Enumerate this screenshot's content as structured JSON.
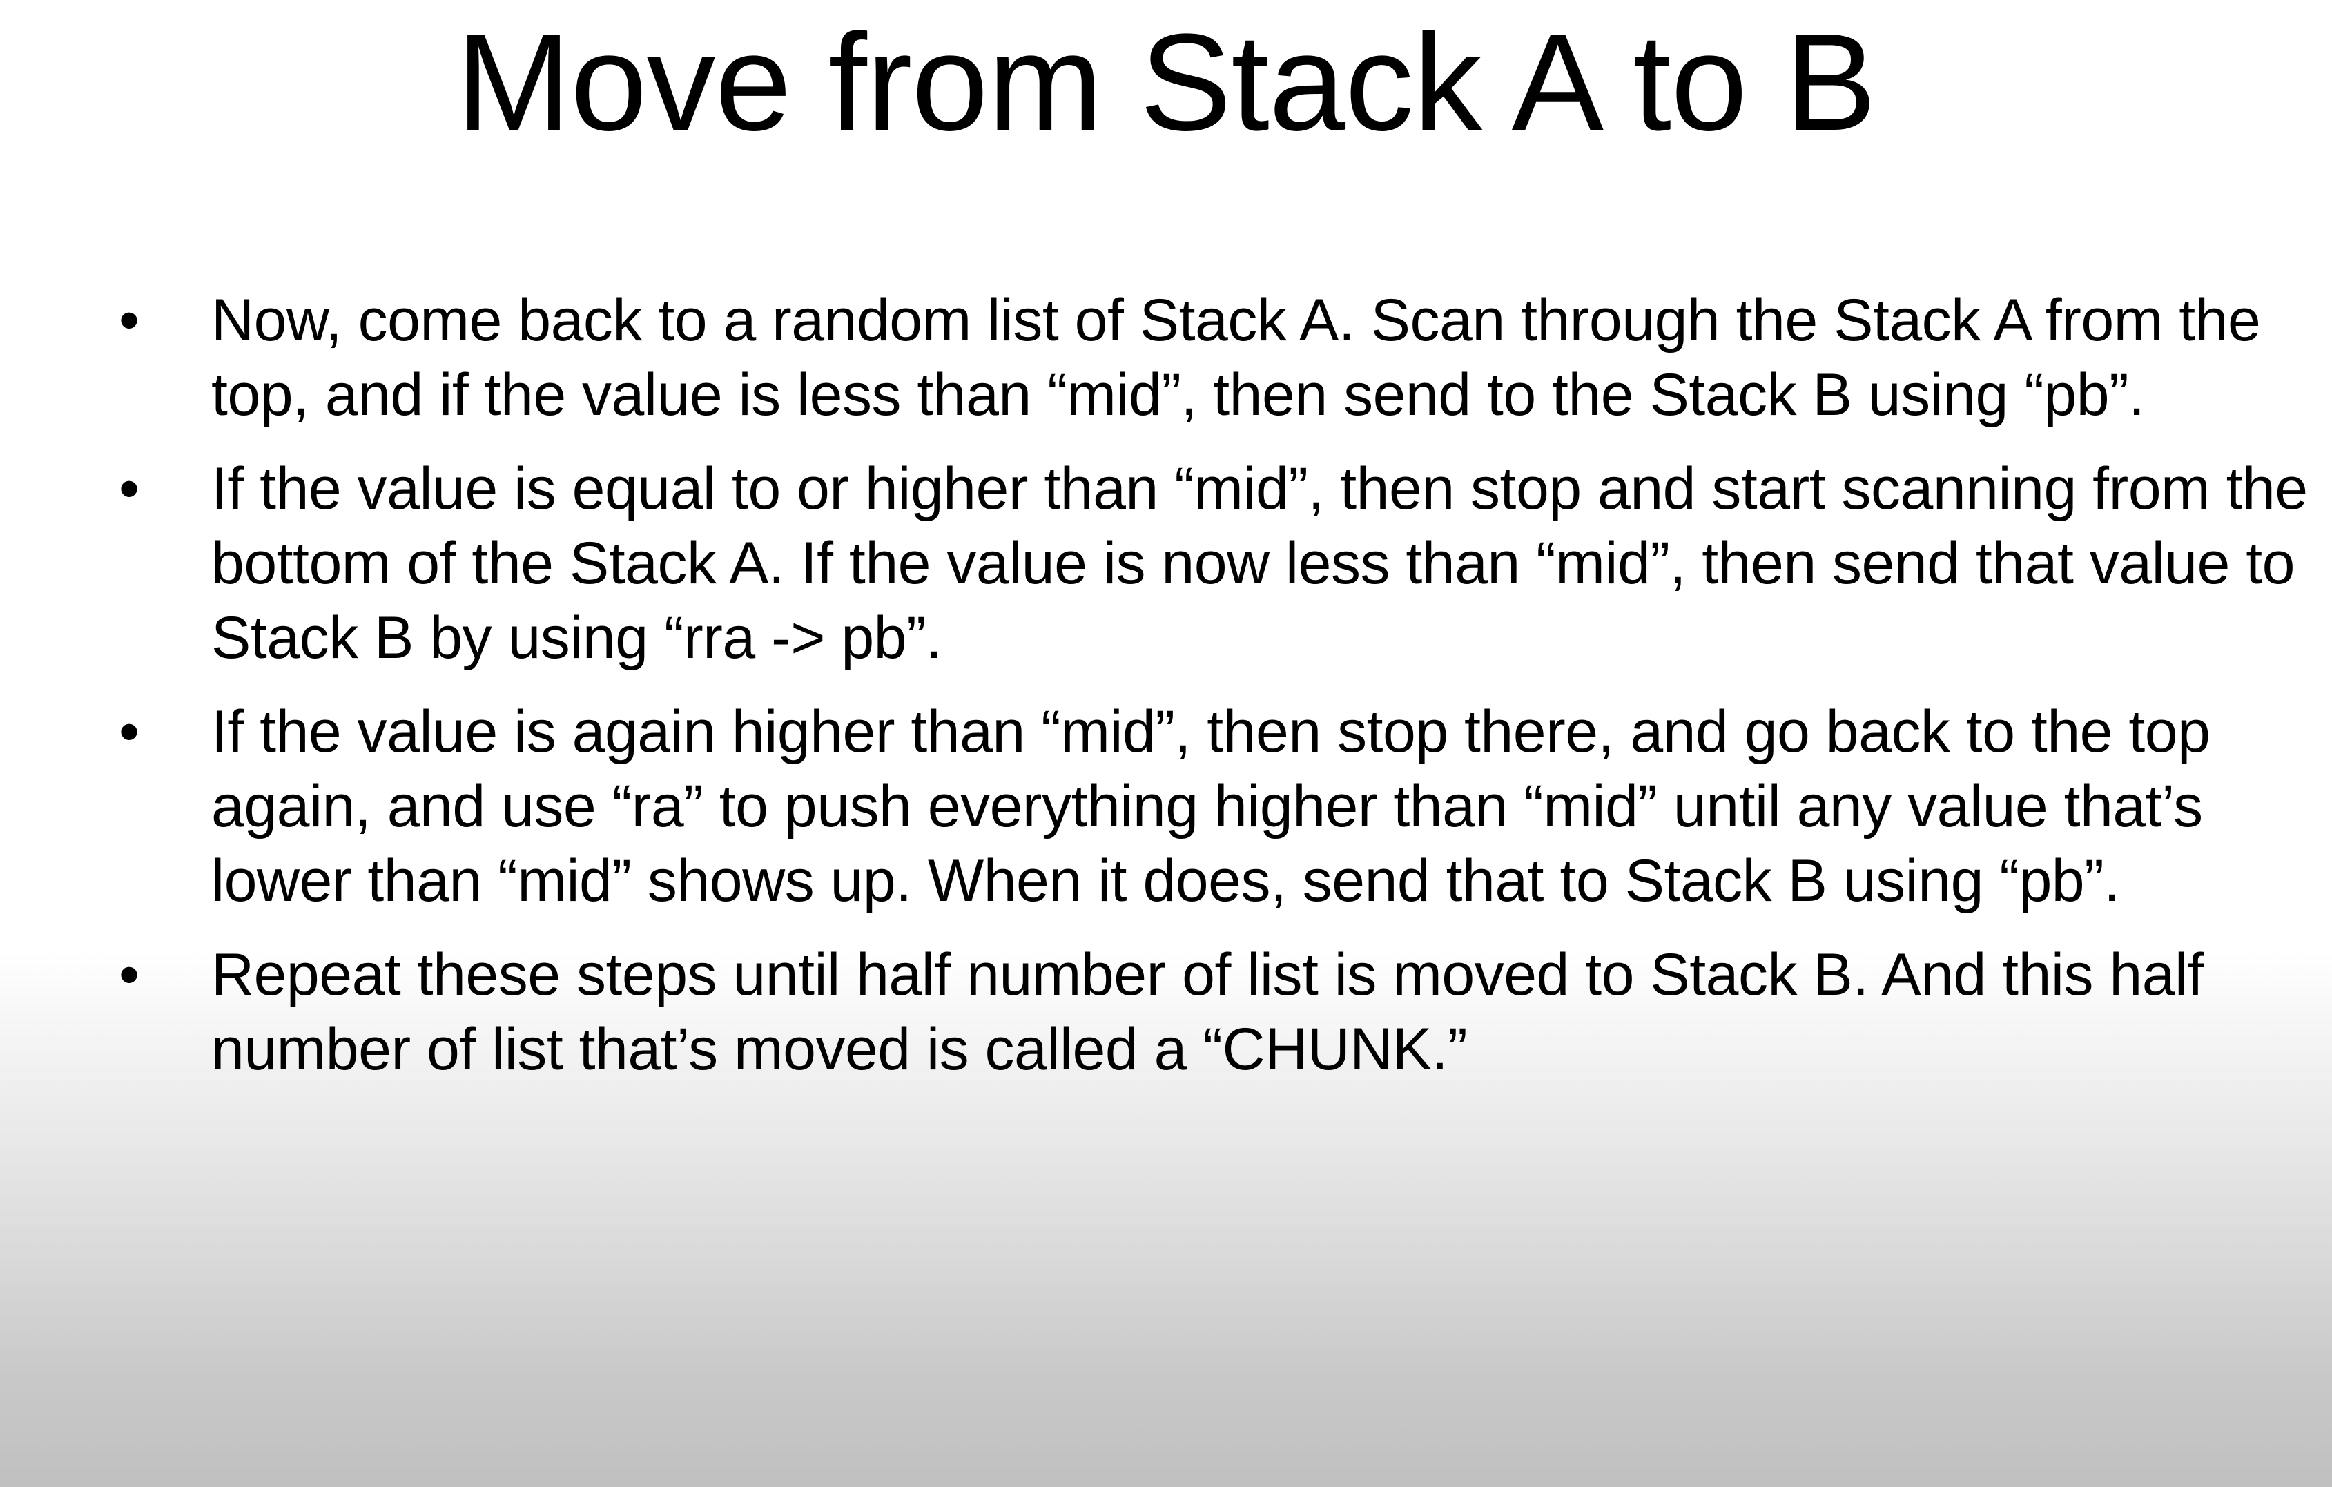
{
  "slide": {
    "title": "Move from Stack A to B",
    "bullet_symbol": "•",
    "bullets": [
      "Now, come back to a random list of Stack A. Scan through the Stack A from the top, and if the value is less than “mid”, then send to the Stack B using “pb”.",
      "If the value is equal to or higher than “mid”, then stop and start scanning from the bottom of the Stack A. If the value is now less than “mid”, then send that value to Stack B by using “rra -> pb”.",
      "If the value is again higher than “mid”, then stop there, and go back to the top again, and use “ra” to push everything higher than “mid” until any value that’s lower than “mid” shows up. When it does, send that to Stack B using “pb”.",
      "Repeat these steps until half number of list is moved to Stack B. And this half number of list that’s moved is called a “CHUNK.”"
    ]
  },
  "colors": {
    "text": "#000000",
    "background_top": "#ffffff",
    "background_bottom": "#c0c0c0"
  }
}
